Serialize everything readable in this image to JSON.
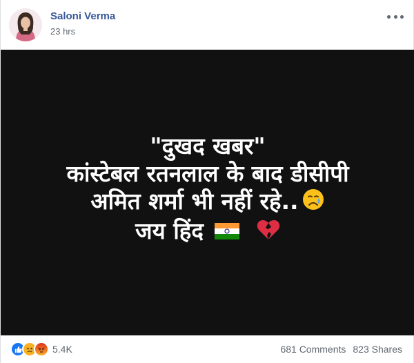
{
  "post": {
    "author": "Saloni Verma",
    "time": "23 hrs",
    "lines": [
      "\"दुखद खबर\"",
      "कांस्टेबल रतनलाल के बाद डीसीपी",
      "अमित शर्मा भी नहीं रहे..",
      "जय हिंद"
    ]
  },
  "footer": {
    "reaction_count": "5.4K",
    "comments": "681 Comments",
    "shares": "823 Shares"
  },
  "icons": {
    "like": "like-reaction-icon",
    "sad": "sad-reaction-icon",
    "angry": "angry-reaction-icon",
    "crying": "crying-face-emoji",
    "flag": "india-flag-emoji",
    "heart": "broken-heart-emoji",
    "more": "more-options-icon"
  },
  "colors": {
    "author_link": "#385898",
    "image_bg": "#121112",
    "like_blue": "#1877f2",
    "sad_yellow": "#f7b125",
    "angry_orange": "#e9710f"
  }
}
